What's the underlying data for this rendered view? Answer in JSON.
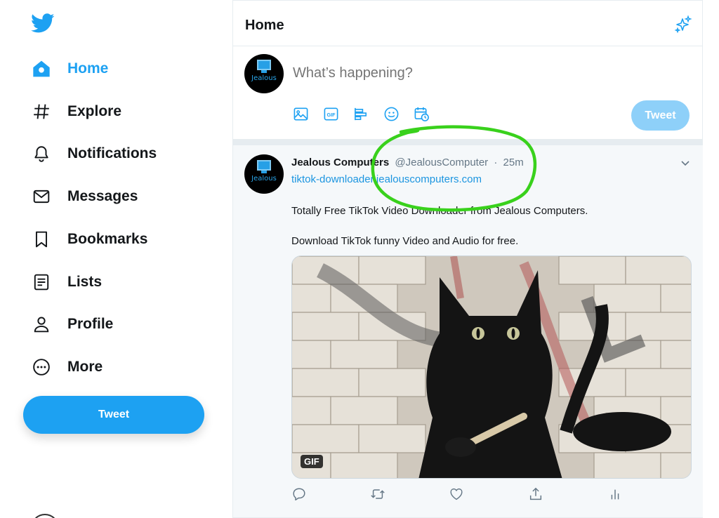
{
  "nav": {
    "items": [
      {
        "label": "Home",
        "icon": "home-icon",
        "active": true
      },
      {
        "label": "Explore",
        "icon": "hashtag-icon",
        "active": false
      },
      {
        "label": "Notifications",
        "icon": "bell-icon",
        "active": false
      },
      {
        "label": "Messages",
        "icon": "envelope-icon",
        "active": false
      },
      {
        "label": "Bookmarks",
        "icon": "bookmark-icon",
        "active": false
      },
      {
        "label": "Lists",
        "icon": "list-icon",
        "active": false
      },
      {
        "label": "Profile",
        "icon": "user-icon",
        "active": false
      },
      {
        "label": "More",
        "icon": "more-circle-icon",
        "active": false
      }
    ],
    "tweet_button": "Tweet"
  },
  "header": {
    "title": "Home"
  },
  "composer": {
    "placeholder": "What’s happening?",
    "avatar_text": "Jealous",
    "tools": [
      "image-icon",
      "gif-icon",
      "poll-icon",
      "emoji-icon",
      "schedule-icon"
    ],
    "tools_gif_label": "GIF",
    "tweet_button": "Tweet"
  },
  "tweet": {
    "avatar_text": "Jealous",
    "name": "Jealous Computers",
    "handle": "@JealousComputer",
    "separator": "·",
    "time": "25m",
    "link": "tiktok-downloader.jealouscomputers.com",
    "body": [
      "Totally Free TikTok Video Downloader from Jealous Computers.",
      "Download TikTok funny Video and Audio for free."
    ],
    "media_badge": "GIF",
    "actions": [
      "reply-icon",
      "retweet-icon",
      "like-icon",
      "share-icon",
      "analytics-icon"
    ]
  },
  "colors": {
    "accent": "#1da1f2",
    "disabled_tweet": "#8ed0f9",
    "annotation": "#39d11c"
  }
}
